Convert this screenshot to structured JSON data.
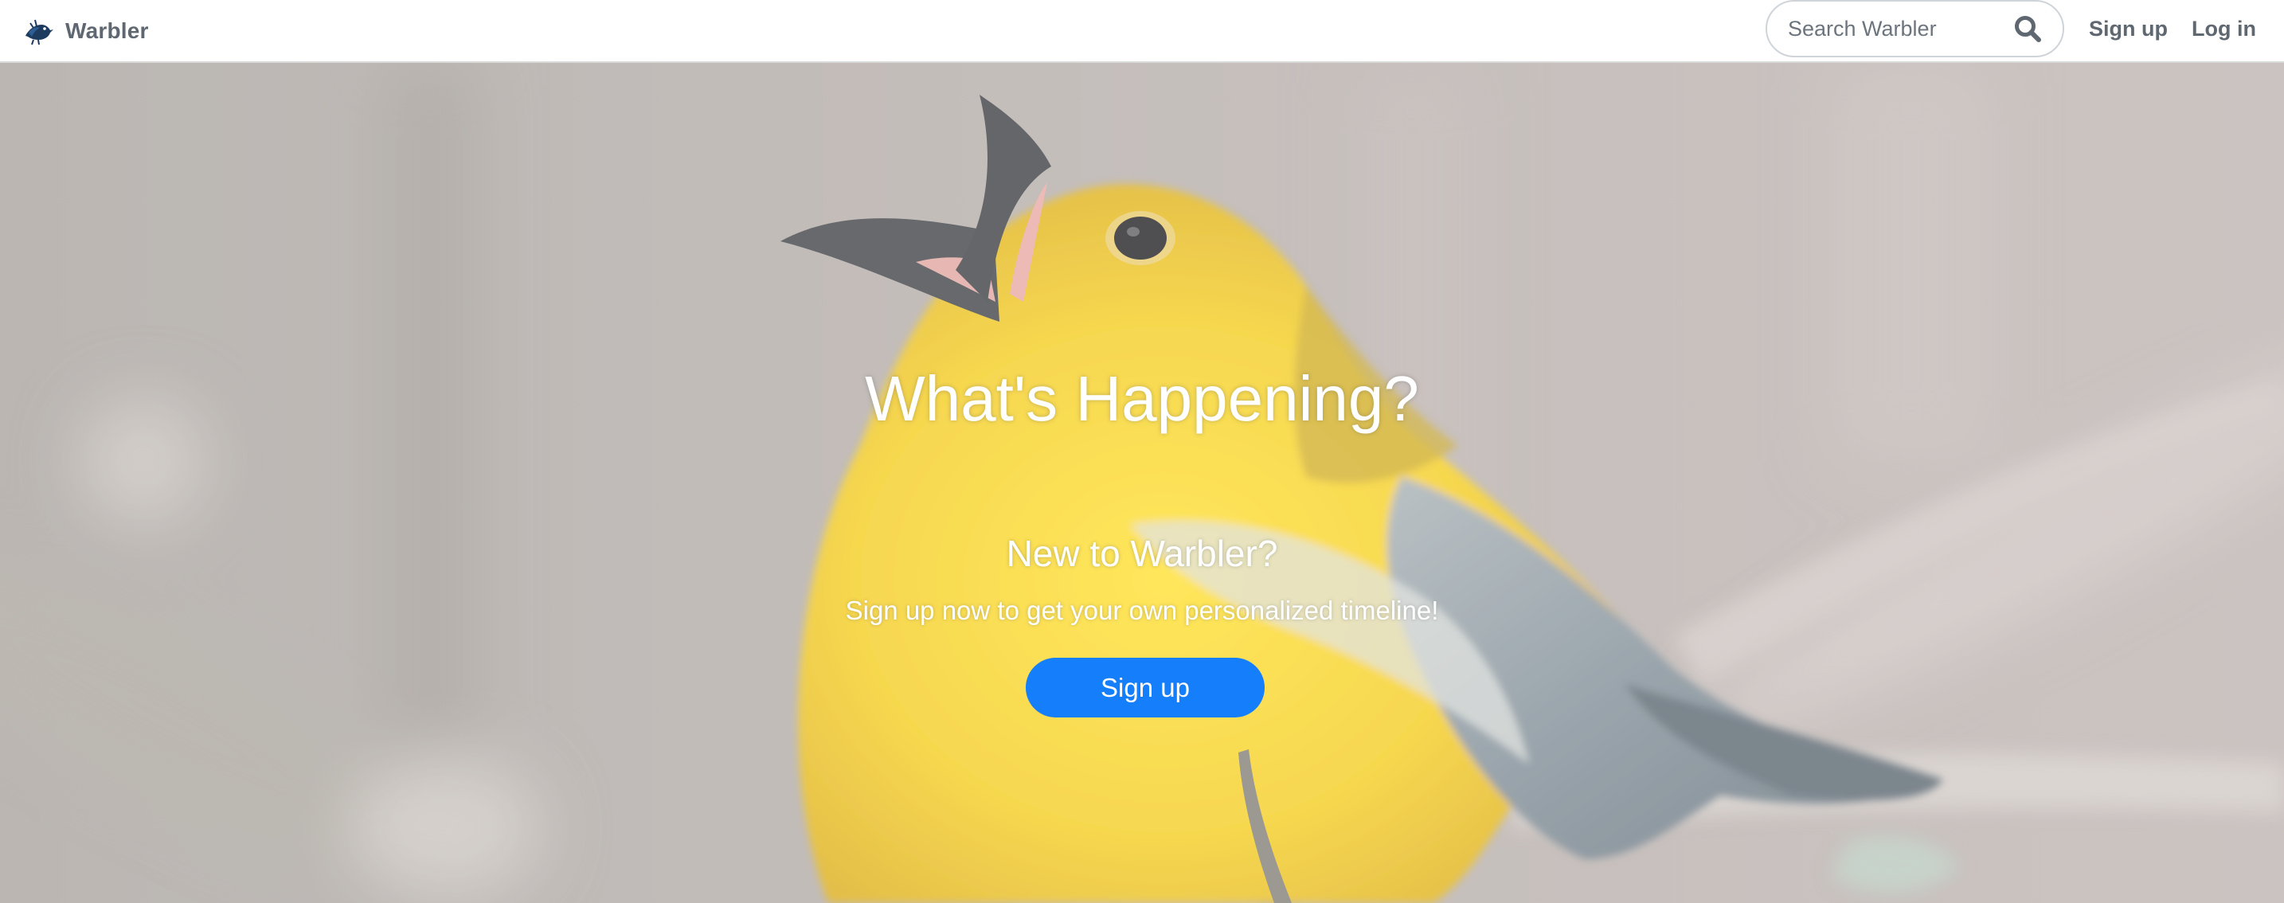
{
  "navbar": {
    "brand_name": "Warbler",
    "logo_icon": "warbler-bird-logo-icon",
    "search": {
      "placeholder": "Search Warbler",
      "value": "",
      "icon": "search-icon"
    },
    "links": {
      "signup_label": "Sign up",
      "login_label": "Log in"
    }
  },
  "hero": {
    "title": "What's Happening?",
    "subtitle": "New to Warbler?",
    "text": "Sign up now to get your own personalized timeline!",
    "button_label": "Sign up",
    "background": "photo-of-yellow-warbler-singing-on-branch"
  },
  "colors": {
    "nav_text": "#5f6770",
    "button_bg": "#147efb",
    "hero_text": "#ffffff",
    "bird_yellow": "#f2cf2a",
    "bird_wing_gray": "#7b8a95",
    "background_blur": "#b6aeac"
  }
}
